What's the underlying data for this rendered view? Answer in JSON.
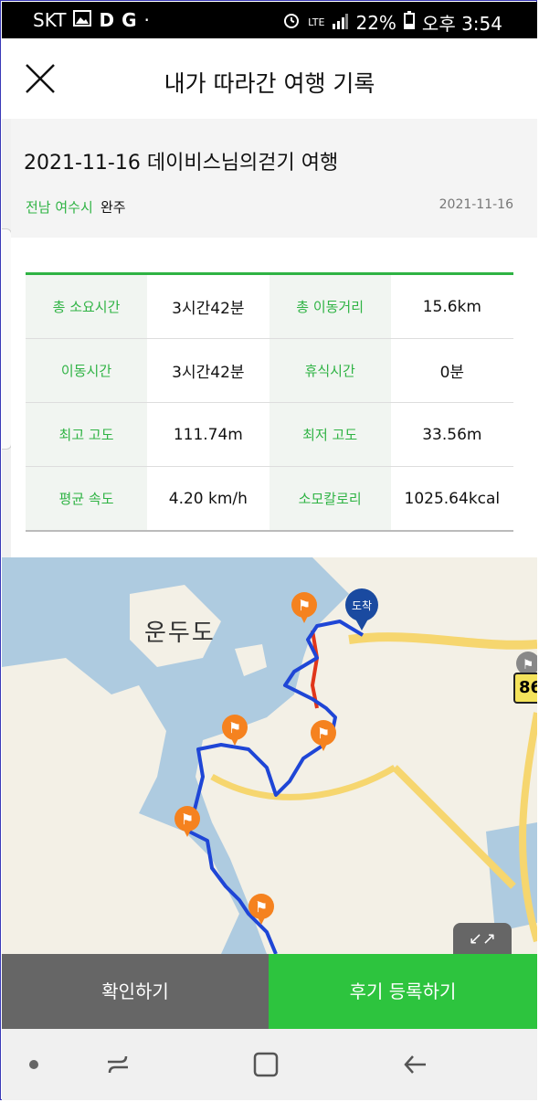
{
  "status": {
    "carrier": "SKT",
    "network": "LTE",
    "battery": "22%",
    "time": "오후 3:54"
  },
  "header": {
    "title": "내가 따라간 여행 기록"
  },
  "trip": {
    "title": "2021-11-16 데이비스님의걷기 여행",
    "region": "전남 여수시",
    "status": "완주",
    "date": "2021-11-16"
  },
  "stats": [
    {
      "k1": "총 소요시간",
      "v1": "3시간42분",
      "k2": "총 이동거리",
      "v2": "15.6km"
    },
    {
      "k1": "이동시간",
      "v1": "3시간42분",
      "k2": "휴식시간",
      "v2": "0분"
    },
    {
      "k1": "최고 고도",
      "v1": "111.74m",
      "k2": "최저 고도",
      "v2": "33.56m"
    },
    {
      "k1": "평균 속도",
      "v1": "4.20 km/h",
      "k2": "소모칼로리",
      "v2": "1025.64kcal"
    }
  ],
  "map": {
    "island_label": "운두도",
    "road_number": "86",
    "arrival_label": "도착",
    "colors": {
      "route": "#1f46d6",
      "route_alt": "#e0361b",
      "flag": "#f5821f",
      "arrival": "#1a4aa0"
    }
  },
  "buttons": {
    "confirm": "확인하기",
    "review": "후기 등록하기"
  },
  "icons": [
    "close-icon",
    "expand-icon",
    "recent-apps-icon",
    "home-icon",
    "back-icon"
  ]
}
